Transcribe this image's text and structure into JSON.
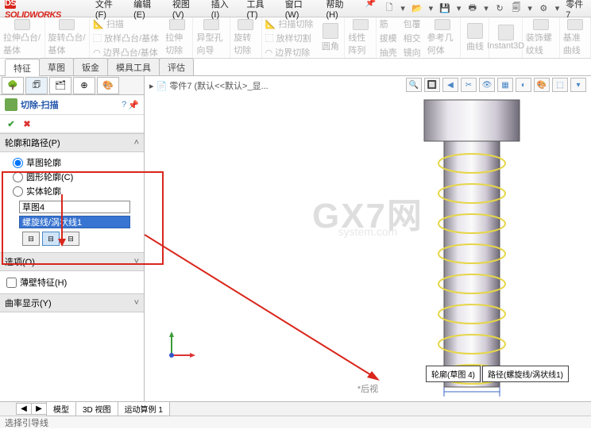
{
  "app": {
    "name": "SOLIDWORKS",
    "doc": "零件7"
  },
  "menu": [
    "文件(F)",
    "编辑(E)",
    "视图(V)",
    "插入(I)",
    "工具(T)",
    "窗口(W)",
    "帮助(H)"
  ],
  "ribbon_large": [
    {
      "label": "拉伸凸台/基体"
    },
    {
      "label": "旋转凸台/基体"
    }
  ],
  "ribbon_col1": [
    "扫描",
    "放样凸台/基体",
    "边界凸台/基体"
  ],
  "ribbon_large2": [
    {
      "label": "拉伸切除"
    },
    {
      "label": "异型孔向导"
    },
    {
      "label": "旋转切除"
    }
  ],
  "ribbon_col2": [
    "扫描切除",
    "放样切割",
    "边界切除"
  ],
  "ribbon_large3": [
    {
      "label": "圆角"
    },
    {
      "label": "线性阵列"
    }
  ],
  "ribbon_col3": [
    "筋",
    "拔模",
    "抽壳"
  ],
  "ribbon_col4": [
    "包覆",
    "相交",
    "镜向"
  ],
  "ribbon_large4": [
    {
      "label": "参考几何体"
    },
    {
      "label": "曲线"
    },
    {
      "label": "Instant3D"
    },
    {
      "label": "装饰螺纹线"
    },
    {
      "label": "基准曲线"
    }
  ],
  "tabs": [
    "特征",
    "草图",
    "钣金",
    "模具工具",
    "评估"
  ],
  "active_tab": "特征",
  "feature": {
    "title": "切除-扫描",
    "section1": "轮廓和路径(P)",
    "radios": [
      "草图轮廓",
      "圆形轮廓(C)",
      "实体轮廓"
    ],
    "profile_field": "草图4",
    "path_field": "螺旋线/涡状线1",
    "section_options": "选项(O)",
    "thin_feature": "薄壁特征(H)",
    "curvature": "曲率显示(Y)"
  },
  "breadcrumb": "零件7 (默认<<默认>_显...",
  "view_label": "*后视",
  "callouts": {
    "profile": "轮廓(草图 4)",
    "path": "路径(螺旋线/涡状线1)"
  },
  "bottom_tabs": [
    "模型",
    "3D 视图",
    "运动算例 1"
  ],
  "status": "选择引导线",
  "watermark": "GX7网",
  "watermark2": "system.com",
  "canvas_tools": [
    "🔍",
    "🔍",
    "🏠",
    "📐",
    "👁",
    "▦",
    "⬜",
    "▾"
  ]
}
